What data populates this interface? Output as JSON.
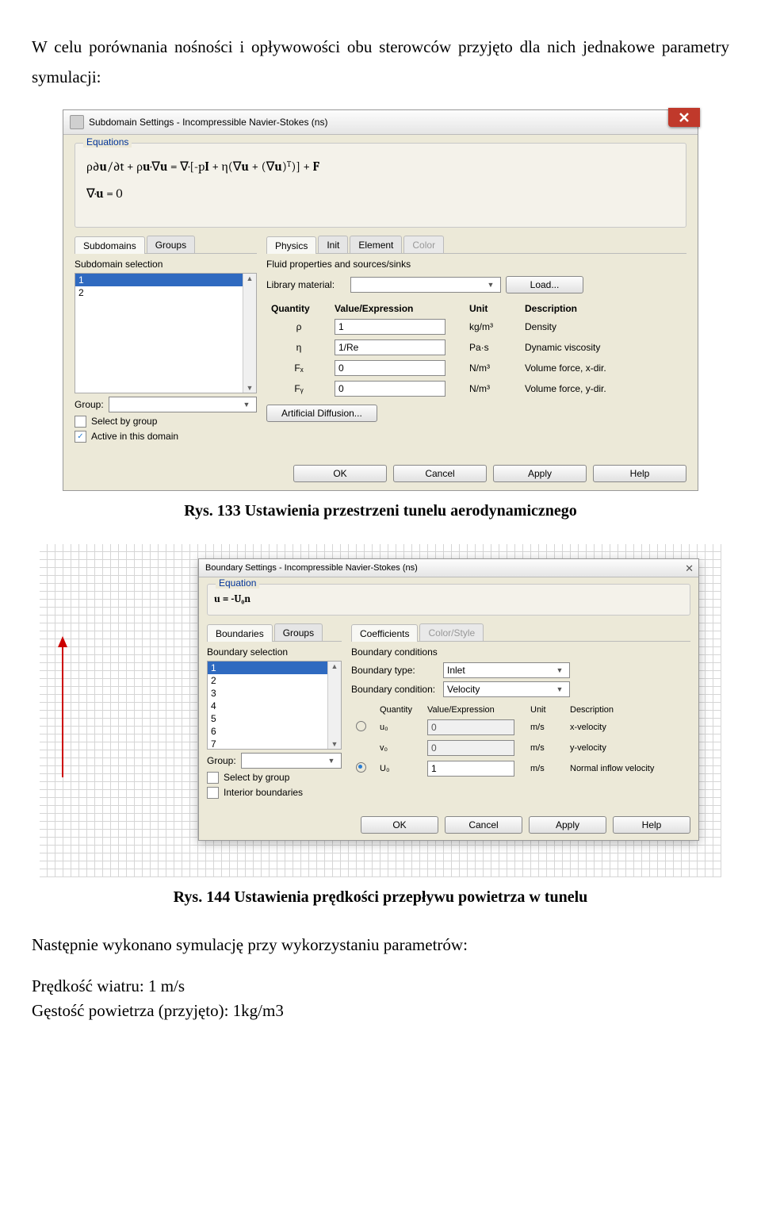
{
  "introText": "W celu porównania nośności i opływowości obu sterowców przyjęto dla nich jednakowe parametry symulacji:",
  "dialog1": {
    "title": "Subdomain Settings - Incompressible Navier-Stokes (ns)",
    "equationsLabel": "Equations",
    "leftTabs": {
      "subdomains": "Subdomains",
      "groups": "Groups"
    },
    "rightTabs": {
      "physics": "Physics",
      "init": "Init",
      "element": "Element",
      "color": "Color"
    },
    "subSelectionLabel": "Subdomain selection",
    "subItems": [
      "1",
      "2"
    ],
    "group": {
      "label": "Group:",
      "value": ""
    },
    "selectByGroup": "Select by group",
    "activeInDomain": "Active in this domain",
    "fluidTitle": "Fluid properties and sources/sinks",
    "libraryMaterial": {
      "label": "Library material:",
      "value": "",
      "loadBtn": "Load..."
    },
    "headers": {
      "quantity": "Quantity",
      "valexpr": "Value/Expression",
      "unit": "Unit",
      "desc": "Description"
    },
    "rows": [
      {
        "q": "ρ",
        "v": "1",
        "u": "kg/m³",
        "d": "Density"
      },
      {
        "q": "η",
        "v": "1/Re",
        "u": "Pa·s",
        "d": "Dynamic viscosity"
      },
      {
        "q": "Fₓ",
        "v": "0",
        "u": "N/m³",
        "d": "Volume force, x-dir."
      },
      {
        "q": "Fᵧ",
        "v": "0",
        "u": "N/m³",
        "d": "Volume force, y-dir."
      }
    ],
    "artDiffBtn": "Artificial Diffusion...",
    "buttons": {
      "ok": "OK",
      "cancel": "Cancel",
      "apply": "Apply",
      "help": "Help"
    }
  },
  "caption1": "Rys. 133 Ustawienia przestrzeni tunelu aerodynamicznego",
  "dialog2": {
    "title": "Boundary Settings - Incompressible Navier-Stokes (ns)",
    "equationLabel": "Equation",
    "equationText": "u = -U₀n",
    "leftTabs": {
      "boundaries": "Boundaries",
      "groups": "Groups"
    },
    "rightTabs": {
      "coeff": "Coefficients",
      "colorstyle": "Color/Style"
    },
    "boundSelLabel": "Boundary selection",
    "items": [
      "1",
      "2",
      "3",
      "4",
      "5",
      "6",
      "7"
    ],
    "group": {
      "label": "Group:",
      "value": ""
    },
    "selectByGroup": "Select by group",
    "interiorBoundaries": "Interior boundaries",
    "bcTitle": "Boundary conditions",
    "boundaryType": {
      "label": "Boundary type:",
      "value": "Inlet"
    },
    "boundaryCond": {
      "label": "Boundary condition:",
      "value": "Velocity"
    },
    "headers": {
      "quantity": "Quantity",
      "valexpr": "Value/Expression",
      "unit": "Unit",
      "desc": "Description"
    },
    "rows": [
      {
        "sel": false,
        "q": "u₀",
        "v": "0",
        "u": "m/s",
        "d": "x-velocity"
      },
      {
        "sel": null,
        "q": "v₀",
        "v": "0",
        "u": "m/s",
        "d": "y-velocity"
      },
      {
        "sel": true,
        "q": "U₀",
        "v": "1",
        "u": "m/s",
        "d": "Normal inflow velocity"
      }
    ],
    "buttons": {
      "ok": "OK",
      "cancel": "Cancel",
      "apply": "Apply",
      "help": "Help"
    }
  },
  "caption2": "Rys. 144 Ustawienia prędkości przepływu powietrza w tunelu",
  "afterText": "Następnie wykonano symulację przy wykorzystaniu parametrów:",
  "param1": "Prędkość wiatru: 1 m/s",
  "param2": "Gęstość powietrza (przyjęto): 1kg/m3"
}
